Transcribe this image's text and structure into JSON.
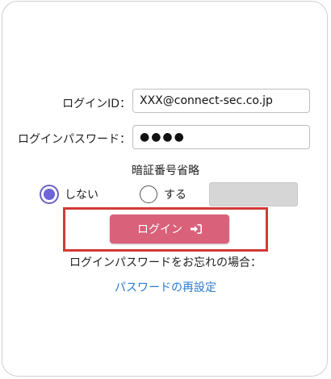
{
  "form": {
    "login_id_label": "ログインID：",
    "login_id_value": "XXX@connect-sec.co.jp",
    "password_label": "ログインパスワード：",
    "password_value": "●●●●"
  },
  "pin": {
    "title": "暗証番号省略",
    "option_no": "しない",
    "option_yes": "する",
    "selected": "しない"
  },
  "login_button": {
    "label": "ログイン",
    "icon": "sign-in-icon",
    "color": "#d9617a"
  },
  "forgot": {
    "text": "ログインパスワードをお忘れの場合：",
    "link": "パスワードの再設定"
  },
  "colors": {
    "highlight": "#d33a35",
    "link": "#2a7bd0",
    "radio_selected": "#6e66d8"
  }
}
